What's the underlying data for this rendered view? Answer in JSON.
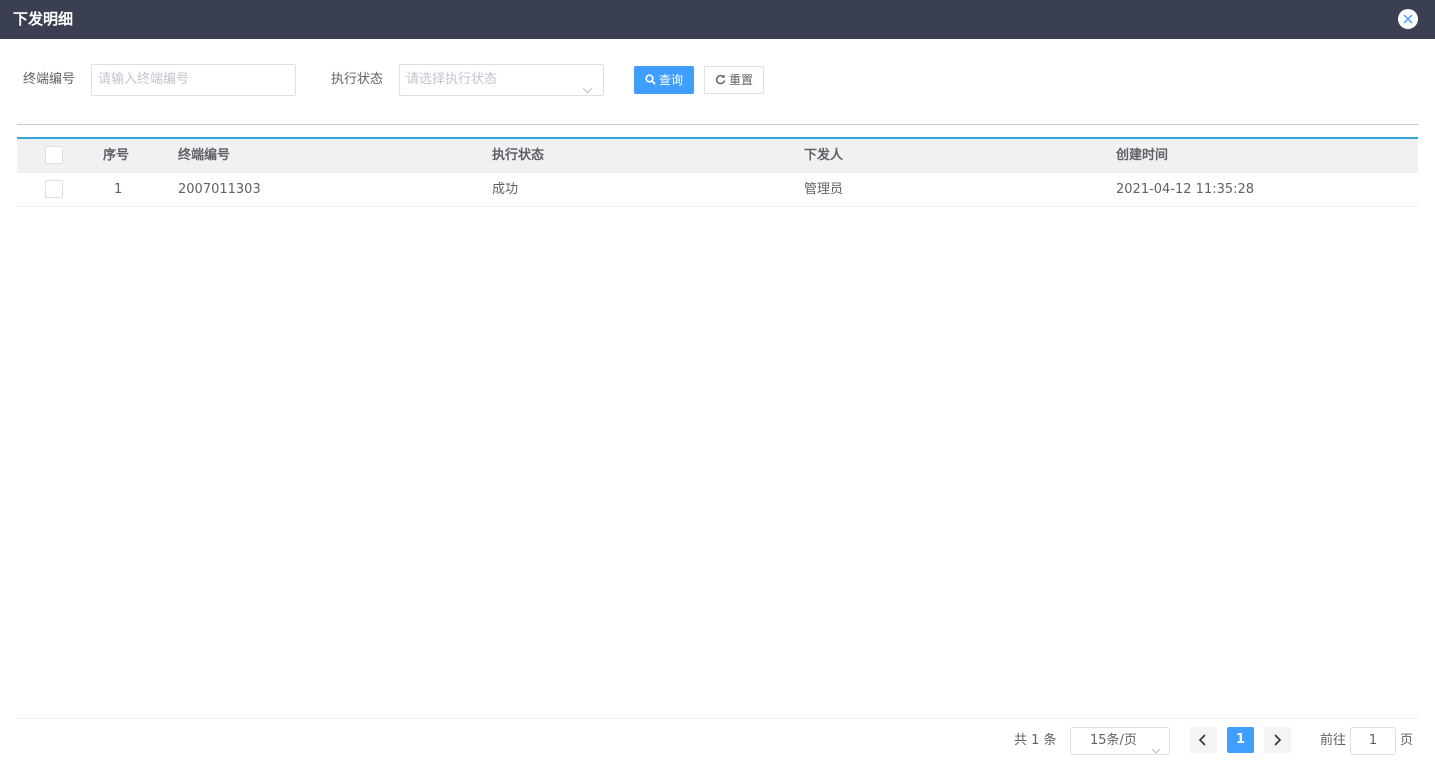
{
  "dialog": {
    "title": "下发明细",
    "close_icon": "close-circle-icon"
  },
  "filters": {
    "terminal_label": "终端编号",
    "terminal_placeholder": "请输入终端编号",
    "terminal_value": "",
    "status_label": "执行状态",
    "status_placeholder": "请选择执行状态",
    "status_value": "",
    "query_label": "查询",
    "query_icon": "search-icon",
    "reset_label": "重置",
    "reset_icon": "refresh-icon"
  },
  "table": {
    "columns": [
      "序号",
      "终端编号",
      "执行状态",
      "下发人",
      "创建时间"
    ],
    "rows": [
      {
        "index": "1",
        "terminal": "2007011303",
        "status": "成功",
        "issuer": "管理员",
        "created": "2021-04-12 11:35:28"
      }
    ]
  },
  "pagination": {
    "total_text": "共 1 条",
    "page_size": "15条/页",
    "current_page": "1",
    "goto_prefix": "前往",
    "goto_value": "1",
    "goto_suffix": "页"
  },
  "colors": {
    "titlebar": "#3a4051",
    "primary": "#409eff",
    "table_top_border": "#36a3d9"
  }
}
